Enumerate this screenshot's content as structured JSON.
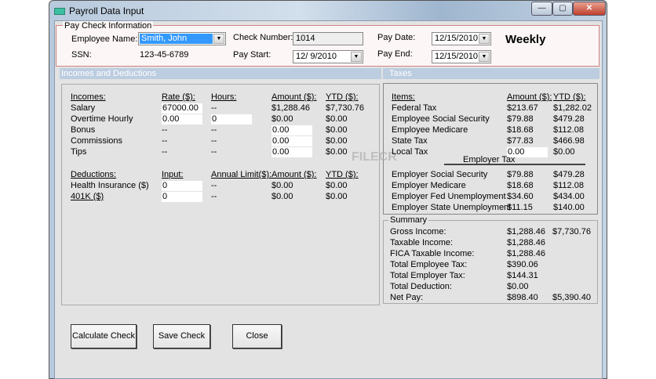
{
  "window": {
    "title": "Payroll Data Input",
    "minimize": "—",
    "maximize": "▢",
    "close": "✕"
  },
  "paycheck": {
    "legend": "Pay Check Information",
    "employee_label": "Employee Name:",
    "employee_value": "Smith, John",
    "ssn_label": "SSN:",
    "ssn_value": "123-45-6789",
    "check_label": "Check Number:",
    "check_value": "1014",
    "paystart_label": "Pay Start:",
    "paystart_value": "12/ 9/2010",
    "paydate_label": "Pay Date:",
    "paydate_value": "12/15/2010",
    "payend_label": "Pay End:",
    "payend_value": "12/15/2010",
    "frequency": "Weekly"
  },
  "incomes_section": {
    "title": "Incomes and Deductions",
    "income_headers": [
      "Incomes:",
      "Rate ($):",
      "Hours:",
      "Amount ($):",
      "YTD ($):"
    ],
    "incomes": [
      {
        "label": "Salary",
        "rate": "67000.00",
        "hours": "--",
        "amount": "$1,288.46",
        "ytd": "$7,730.76"
      },
      {
        "label": "Overtime Hourly",
        "rate": "0.00",
        "hours": "0",
        "amount": "$0.00",
        "ytd": "$0.00"
      },
      {
        "label": "Bonus",
        "rate": "--",
        "hours": "--",
        "amount": "0.00",
        "ytd": "$0.00"
      },
      {
        "label": "Commissions",
        "rate": "--",
        "hours": "--",
        "amount": "0.00",
        "ytd": "$0.00"
      },
      {
        "label": "Tips",
        "rate": "--",
        "hours": "--",
        "amount": "0.00",
        "ytd": "$0.00"
      }
    ],
    "deduction_headers": [
      "Deductions:",
      "Input:",
      "Annual Limit($):",
      "Amount ($):",
      "YTD ($):"
    ],
    "deductions": [
      {
        "label": "Health Insurance  ($)",
        "input": "0",
        "limit": "--",
        "amount": "$0.00",
        "ytd": "$0.00"
      },
      {
        "label": "401K  ($)",
        "input": "0",
        "limit": "--",
        "amount": "$0.00",
        "ytd": "$0.00"
      }
    ]
  },
  "taxes_section": {
    "title": "Taxes",
    "headers": [
      "Items:",
      "Amount ($):",
      "YTD ($):"
    ],
    "employee_taxes": [
      {
        "label": "Federal Tax",
        "amount": "$213.67",
        "ytd": "$1,282.02"
      },
      {
        "label": "Employee Social Security",
        "amount": "$79.88",
        "ytd": "$479.28"
      },
      {
        "label": "Employee Medicare",
        "amount": "$18.68",
        "ytd": "$112.08"
      },
      {
        "label": "State Tax",
        "amount": "$77.83",
        "ytd": "$466.98"
      },
      {
        "label": "Local Tax",
        "amount": "0.00",
        "ytd": "$0.00"
      }
    ],
    "employer_title": "Employer Tax",
    "employer_taxes": [
      {
        "label": "Employer Social Security",
        "amount": "$79.88",
        "ytd": "$479.28"
      },
      {
        "label": "Employer Medicare",
        "amount": "$18.68",
        "ytd": "$112.08"
      },
      {
        "label": "Employer Fed Unemployment",
        "amount": "$34.60",
        "ytd": "$434.00"
      },
      {
        "label": "Employer State Unemployment",
        "amount": "$11.15",
        "ytd": "$140.00"
      }
    ]
  },
  "summary": {
    "legend": "Summary",
    "rows": [
      {
        "label": "Gross Income:",
        "amount": "$1,288.46",
        "ytd": "$7,730.76"
      },
      {
        "label": "Taxable Income:",
        "amount": "$1,288.46",
        "ytd": ""
      },
      {
        "label": "FICA Taxable Income:",
        "amount": "$1,288.46",
        "ytd": ""
      },
      {
        "label": "Total Employee Tax:",
        "amount": "$390.06",
        "ytd": ""
      },
      {
        "label": "Total Employer Tax:",
        "amount": "$144.31",
        "ytd": ""
      },
      {
        "label": "Total Deduction:",
        "amount": "$0.00",
        "ytd": ""
      },
      {
        "label": "Net Pay:",
        "amount": "$898.40",
        "ytd": "$5,390.40"
      }
    ]
  },
  "buttons": {
    "calculate": "Calculate Check",
    "save": "Save Check",
    "close": "Close"
  },
  "watermark": "FILECR"
}
